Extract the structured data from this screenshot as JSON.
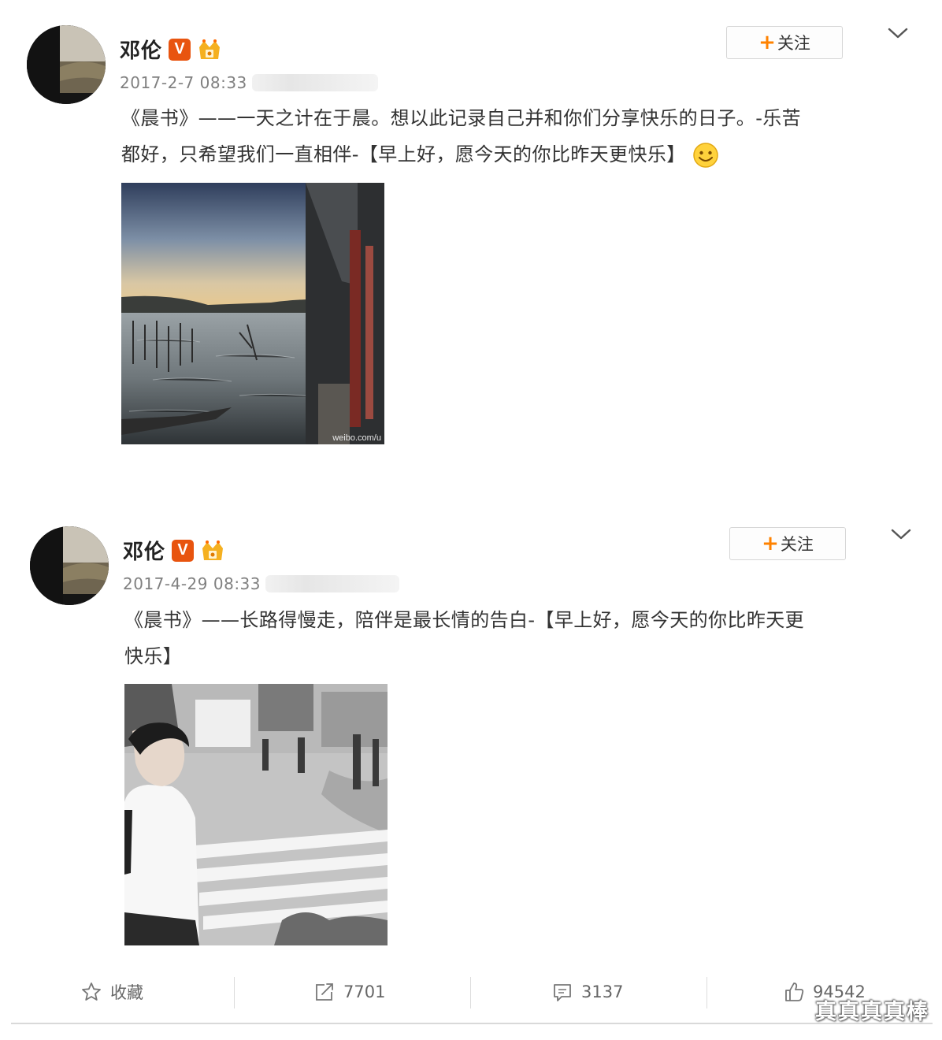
{
  "posts": [
    {
      "username": "邓伦",
      "verified_badge": "V",
      "timestamp": "2017-2-7 08:33",
      "follow_label": "关注",
      "text_line1": "《晨书》——一天之计在于晨。想以此记录自己并和你们分享快乐的日子。-乐苦",
      "text_line2": "都好，只希望我们一直相伴-【早上好，愿今天的你比昨天更快乐】",
      "image_watermark": "weibo.com/u"
    },
    {
      "username": "邓伦",
      "verified_badge": "V",
      "timestamp": "2017-4-29 08:33",
      "follow_label": "关注",
      "text_line1": "《晨书》——长路得慢走，陪伴是最长情的告白-【早上好，愿今天的你比昨天更",
      "text_line2": "快乐】"
    }
  ],
  "actions": {
    "favorite_label": "收藏",
    "repost_count": "7701",
    "comment_count": "3137",
    "like_count": "94542"
  },
  "watermark": "真真真真棒",
  "icons": {
    "follow": "plus-icon",
    "more": "chevron-down-icon",
    "favorite": "star-icon",
    "repost": "repost-icon",
    "comment": "comment-icon",
    "like": "thumbs-up-icon",
    "emoji": "smile-emoji-icon",
    "crown": "crown-badge-icon"
  },
  "colors": {
    "accent": "#ff8200",
    "verified": "#e8540f",
    "timestamp": "#808080"
  }
}
